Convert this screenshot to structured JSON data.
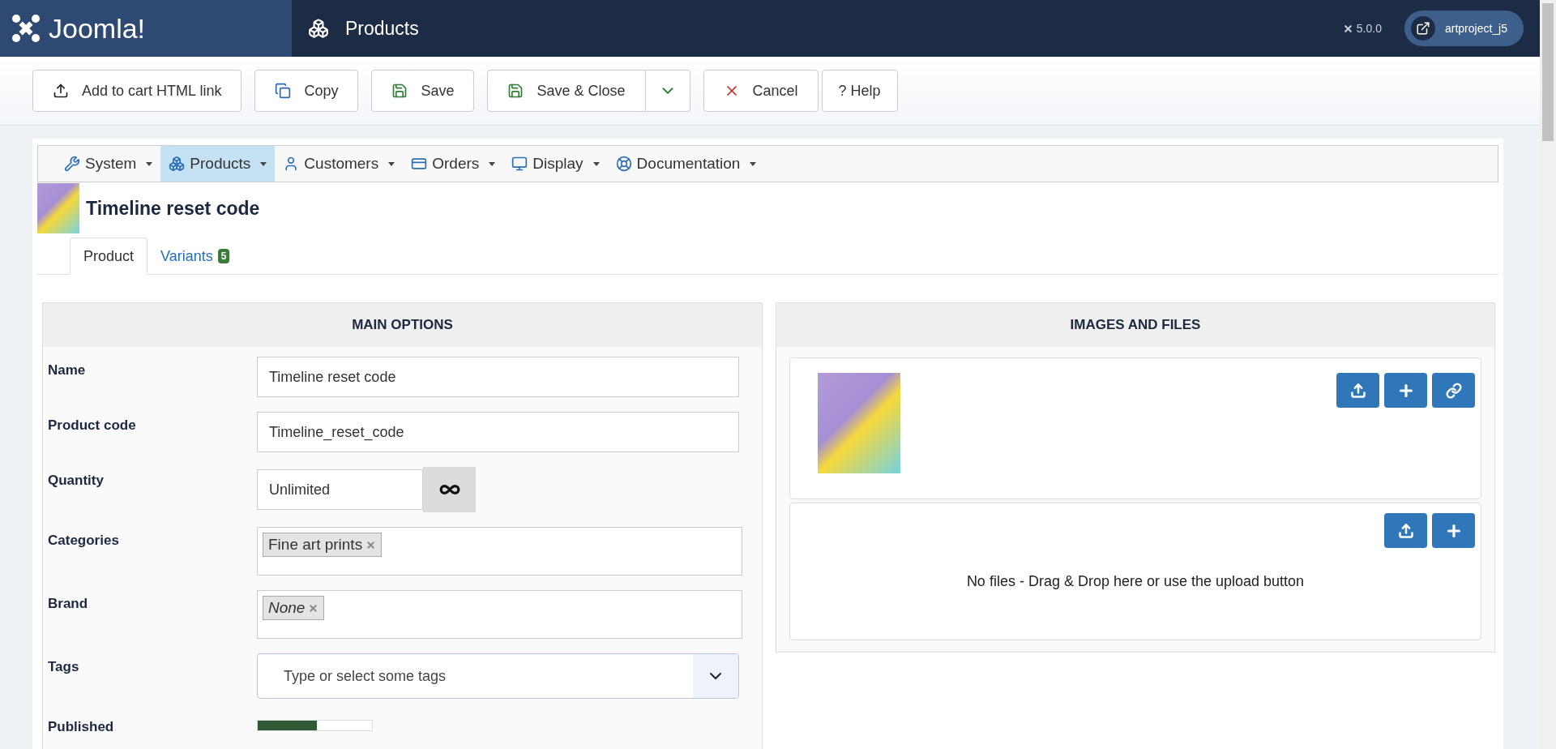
{
  "header": {
    "logo": "Joomla!",
    "title": "Products",
    "version": "5.0.0",
    "user": "artproject_j5"
  },
  "toolbar": [
    {
      "kind": "button",
      "label": "Add to cart HTML link"
    },
    {
      "kind": "button",
      "label": "Copy"
    },
    {
      "kind": "button",
      "label": "Save"
    },
    {
      "kind": "split",
      "label": "Save & Close"
    },
    {
      "kind": "cancel",
      "label": "Cancel"
    },
    {
      "kind": "plain",
      "label": "? Help"
    }
  ],
  "menu": [
    {
      "label": "System",
      "selected": false
    },
    {
      "label": "Products",
      "selected": true
    },
    {
      "label": "Customers",
      "selected": false
    },
    {
      "label": "Orders",
      "selected": false
    },
    {
      "label": "Display",
      "selected": false
    },
    {
      "label": "Documentation",
      "selected": false
    }
  ],
  "product_title": "Timeline reset code",
  "tabs": [
    {
      "label": "Product",
      "selected": true
    },
    {
      "label": "Variants",
      "badge": "5",
      "selected": false
    }
  ],
  "main_options": {
    "title": "MAIN OPTIONS",
    "fields": [
      {
        "kind": "text",
        "label": "Name",
        "value": "Timeline reset code"
      },
      {
        "kind": "text",
        "label": "Product code",
        "value": "Timeline_reset_code"
      },
      {
        "kind": "quantity",
        "label": "Quantity",
        "value": "Unlimited"
      },
      {
        "kind": "chips",
        "label": "Categories",
        "chips": [
          {
            "label": "Fine art prints",
            "empty": false
          }
        ]
      },
      {
        "kind": "chips",
        "label": "Brand",
        "chips": [
          {
            "label": "None",
            "empty": true
          }
        ]
      },
      {
        "kind": "select",
        "label": "Tags",
        "placeholder": "Type or select some tags"
      },
      {
        "kind": "toggle",
        "label": "Published",
        "on": true
      }
    ]
  },
  "images_and_files": {
    "title": "IMAGES AND FILES",
    "files_message": "No files - Drag & Drop here or use the upload button"
  }
}
